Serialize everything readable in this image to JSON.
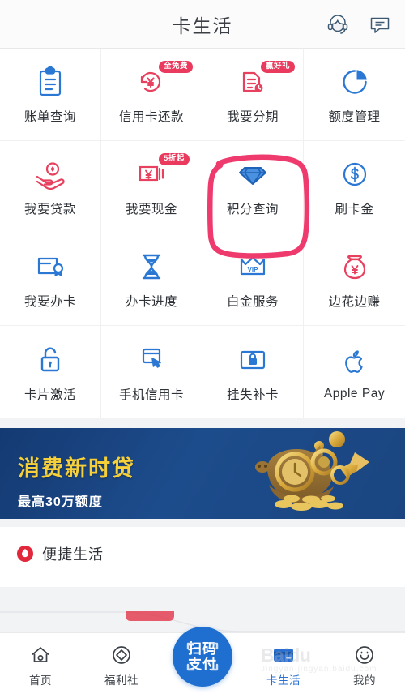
{
  "header": {
    "title": "卡生活",
    "icons": [
      {
        "name": "customer-service-icon",
        "label": "在线客服"
      },
      {
        "name": "message-icon",
        "label": "消息"
      }
    ]
  },
  "grid": {
    "items": [
      {
        "label": "账单查询",
        "icon": "clipboard-icon",
        "color": "#2a78d4",
        "badge": null
      },
      {
        "label": "信用卡还款",
        "icon": "repay-yen-icon",
        "color": "#e8405f",
        "badge": "全免费"
      },
      {
        "label": "我要分期",
        "icon": "installment-icon",
        "color": "#e8405f",
        "badge": "赢好礼"
      },
      {
        "label": "额度管理",
        "icon": "pie-chart-icon",
        "color": "#2a78d4",
        "badge": null
      },
      {
        "label": "我要贷款",
        "icon": "hand-coin-icon",
        "color": "#e8405f",
        "badge": null
      },
      {
        "label": "我要现金",
        "icon": "banknote-yen-icon",
        "color": "#e8405f",
        "badge": "5折起"
      },
      {
        "label": "积分查询",
        "icon": "diamond-icon",
        "color": "#2a78d4",
        "badge": null
      },
      {
        "label": "刷卡金",
        "icon": "dollar-circle-icon",
        "color": "#2a78d4",
        "badge": null
      },
      {
        "label": "我要办卡",
        "icon": "card-badge-icon",
        "color": "#2a78d4",
        "badge": null
      },
      {
        "label": "办卡进度",
        "icon": "hourglass-icon",
        "color": "#2a78d4",
        "badge": null
      },
      {
        "label": "白金服务",
        "icon": "vip-crown-icon",
        "color": "#2a78d4",
        "badge": null
      },
      {
        "label": "边花边赚",
        "icon": "money-bag-icon",
        "color": "#e8405f",
        "badge": null
      },
      {
        "label": "卡片激活",
        "icon": "unlock-icon",
        "color": "#2a78d4",
        "badge": null
      },
      {
        "label": "手机信用卡",
        "icon": "mobile-card-icon",
        "color": "#2a78d4",
        "badge": null
      },
      {
        "label": "挂失补卡",
        "icon": "locked-card-icon",
        "color": "#2a78d4",
        "badge": null
      },
      {
        "label": "Apple Pay",
        "icon": "apple-icon",
        "color": "#2a78d4",
        "badge": null
      }
    ]
  },
  "banner": {
    "title": "消费新时贷",
    "subtitle": "最高30万额度",
    "art": "golden-piggy-bank",
    "bg_color": "#1a4580",
    "title_color": "#f5d03a"
  },
  "section": {
    "title": "便捷生活",
    "dot_icon": "red-drop-icon",
    "dot_color": "#e2283c"
  },
  "annotation": {
    "shape": "hand-drawn-circle",
    "target": "积分查询",
    "color": "#ef3a6e"
  },
  "tabbar": {
    "items": [
      {
        "label": "首页",
        "icon": "home-icon",
        "active": false
      },
      {
        "label": "福利社",
        "icon": "benefits-diamond-icon",
        "active": false
      },
      {
        "label": "扫码支付",
        "icon": "scan-pay-icon",
        "active": false,
        "is_center": true
      },
      {
        "label": "卡生活",
        "icon": "credit-card-icon",
        "active": true
      },
      {
        "label": "我的",
        "icon": "profile-smile-icon",
        "active": false
      }
    ],
    "scan_line1": "扫码",
    "scan_line2": "支付"
  },
  "watermark": {
    "main": "Baidu",
    "sub": "Jingyan·jingyan.baidu.com"
  }
}
